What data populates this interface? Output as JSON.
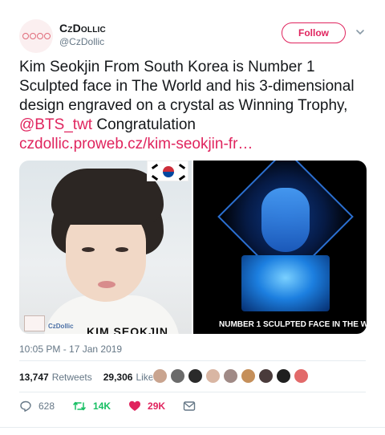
{
  "author": {
    "display_name": "CzDollic",
    "handle": "@CzDollic",
    "avatar_icon": "czdollic-logo-icon"
  },
  "follow_button": {
    "label": "Follow",
    "color": "#e0245e"
  },
  "tweet": {
    "text_part1": "Kim Seokjin From South Korea is Number 1 Sculpted face in The World and his 3-dimensional design engraved on a crystal as Winning Trophy, ",
    "mention": "@BTS_twt",
    "text_part2": " Congratulation",
    "link": "czdollic.proweb.cz/kim-seokjin-fr…",
    "link_color": "#e0245e"
  },
  "media": {
    "left_photo": {
      "name_strip": "KIM SEOKJIN",
      "logo_text": "CzDollic"
    },
    "right_photo": {
      "caption": "NUMBER 1 SCULPTED FACE IN THE W"
    }
  },
  "timestamp": "10:05 PM - 17 Jan 2019",
  "stats": {
    "retweets_count": "13,747",
    "retweets_label": "Retweets",
    "likes_count": "29,306",
    "likes_label": "Likes",
    "liker_avatars": [
      "#c9a48f",
      "#6b6b6b",
      "#2a2a2a",
      "#d9b6a3",
      "#a08a86",
      "#c58f5a",
      "#4a3b3b",
      "#1f1f1f",
      "#e26a6a"
    ]
  },
  "actions": {
    "reply_count": "628",
    "retweet_count": "14K",
    "like_count": "29K",
    "reply_icon": "reply-icon",
    "retweet_icon": "retweet-icon",
    "like_icon": "heart-icon",
    "dm_icon": "envelope-icon"
  }
}
